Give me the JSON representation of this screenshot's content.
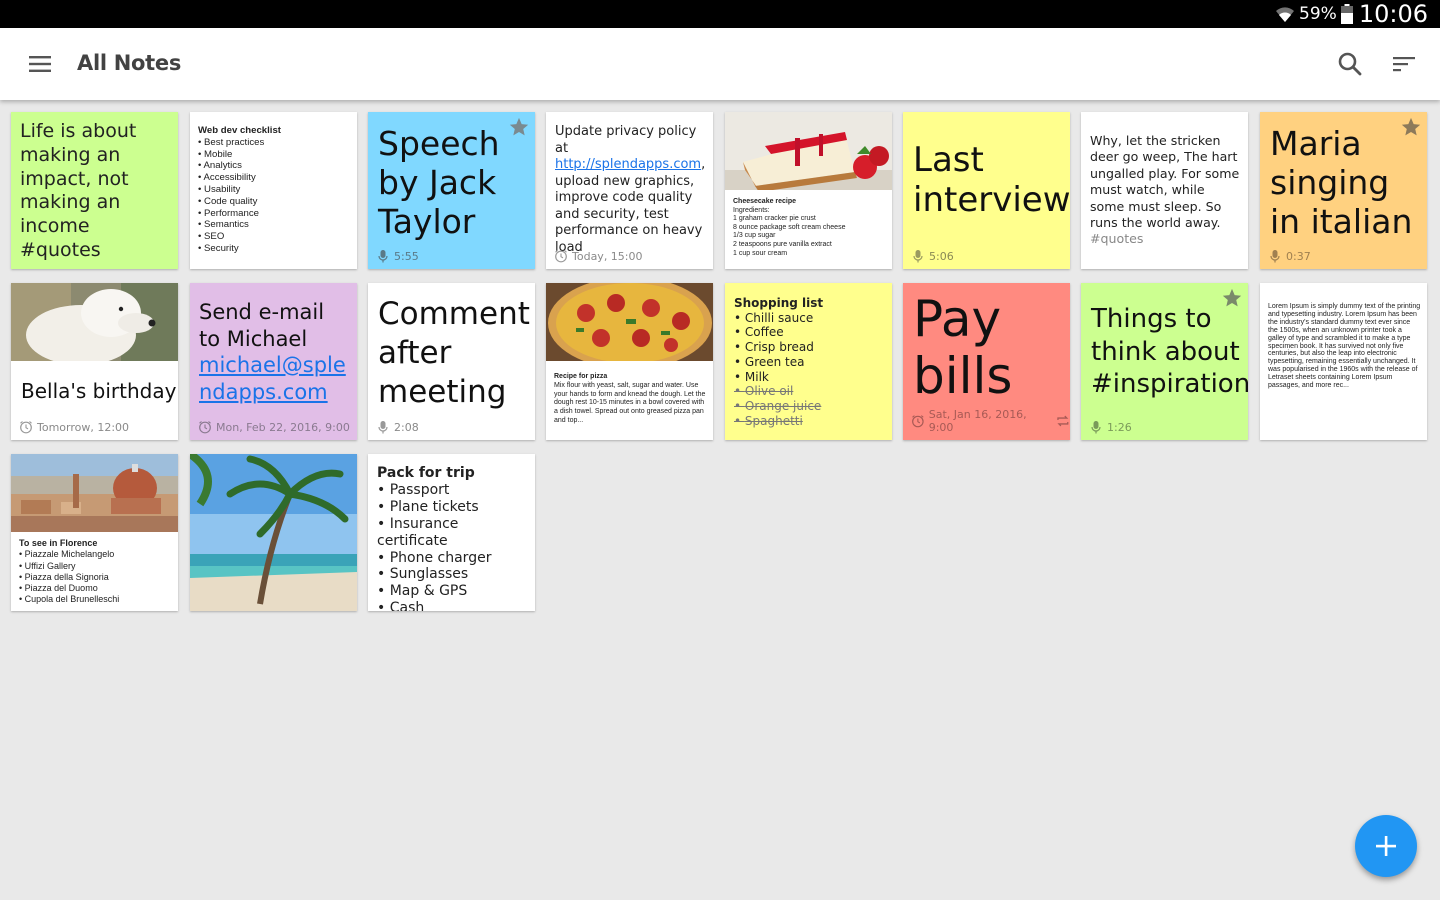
{
  "status_bar": {
    "battery": "59%",
    "time": "10:06"
  },
  "app_bar": {
    "title": "All Notes"
  },
  "notes": {
    "life": {
      "text": "Life is about making an impact, not making an income #quotes"
    },
    "webdev": {
      "title": "Web dev checklist",
      "items": [
        "Best practices",
        "Mobile",
        "Analytics",
        "Accessibility",
        "Usability",
        "Code quality",
        "Performance",
        "Semantics",
        "SEO",
        "Security"
      ]
    },
    "speech": {
      "text": "Speech by Jack Taylor",
      "duration": "5:55"
    },
    "privacy": {
      "text_before": "Update privacy policy at ",
      "link": "http://splendapps.com",
      "text_after": ", upload new graphics, improve code quality and security, test performance on heavy load",
      "reminder": "Today, 15:00"
    },
    "cheesecake": {
      "title": "Cheesecake recipe",
      "lines": [
        "Ingredients:",
        "1 graham cracker pie crust",
        "8 ounce package soft cream cheese",
        "1/3 cup sugar",
        "2 teaspoons pure vanilla extract",
        "1 cup sour cream"
      ]
    },
    "interview": {
      "text": "Last interview",
      "duration": "5:06"
    },
    "poem": {
      "text": "Why, let the stricken deer go weep, The hart ungalled play. For some must watch, while some must sleep. So runs the world away.",
      "tag": "#quotes"
    },
    "maria": {
      "text": "Maria singing in italian",
      "duration": "0:37"
    },
    "bella": {
      "text": "Bella's birthday",
      "reminder": "Tomorrow, 12:00"
    },
    "email": {
      "text": "Send e-mail to Michael",
      "link": "michael@splendapps.com",
      "reminder": "Mon, Feb 22, 2016, 9:00"
    },
    "comment": {
      "text": "Comment after meeting",
      "duration": "2:08"
    },
    "pizza": {
      "title": "Recipe for pizza",
      "text": "Mix flour with yeast, salt, sugar and water. Use your hands to form and knead the dough. Let the dough rest 10-15 minutes in a bowl covered with a dish towel. Spread out onto greased pizza pan and top..."
    },
    "shopping": {
      "title": "Shopping list",
      "items": [
        "Chilli sauce",
        "Coffee",
        "Crisp bread",
        "Green tea",
        "Milk"
      ],
      "done": [
        "Olive oil",
        "Orange juice",
        "Spaghetti"
      ]
    },
    "bills": {
      "text": "Pay bills",
      "reminder": "Sat, Jan 16, 2016, 9:00"
    },
    "things": {
      "text": "Things to think about #inspiration",
      "duration": "1:26"
    },
    "lorem": {
      "text": "Lorem Ipsum is simply dummy text of the printing and typesetting industry. Lorem Ipsum has been the industry's standard dummy text ever since the 1500s, when an unknown printer took a galley of type and scrambled it to make a type specimen book. It has survived not only five centuries, but also the leap into electronic typesetting, remaining essentially unchanged. It was popularised in the 1960s with the release of Letraset sheets containing Lorem Ipsum passages, and more rec..."
    },
    "florence": {
      "title": "To see in Florence",
      "items": [
        "Piazzale Michelangelo",
        "Uffizi Gallery",
        "Piazza della Signoria",
        "Piazza del Duomo",
        "Cupola del Brunelleschi"
      ]
    },
    "trip": {
      "title": "Pack for trip",
      "items": [
        "Passport",
        "Plane tickets",
        "Insurance certificate",
        "Phone charger",
        "Sunglasses",
        "Map & GPS",
        "Cash"
      ]
    }
  },
  "colors": {
    "green": "#ccff90",
    "blue": "#80d8ff",
    "yellow": "#ffff8d",
    "orange": "#ffd180",
    "purple": "#e1bee7",
    "red": "#ff8a80",
    "white": "#ffffff",
    "fab": "#2196f3"
  },
  "icons": [
    "wifi-icon",
    "battery-icon",
    "menu-icon",
    "search-icon",
    "sort-icon",
    "star-icon",
    "mic-icon",
    "alarm-icon",
    "repeat-icon",
    "add-icon"
  ]
}
